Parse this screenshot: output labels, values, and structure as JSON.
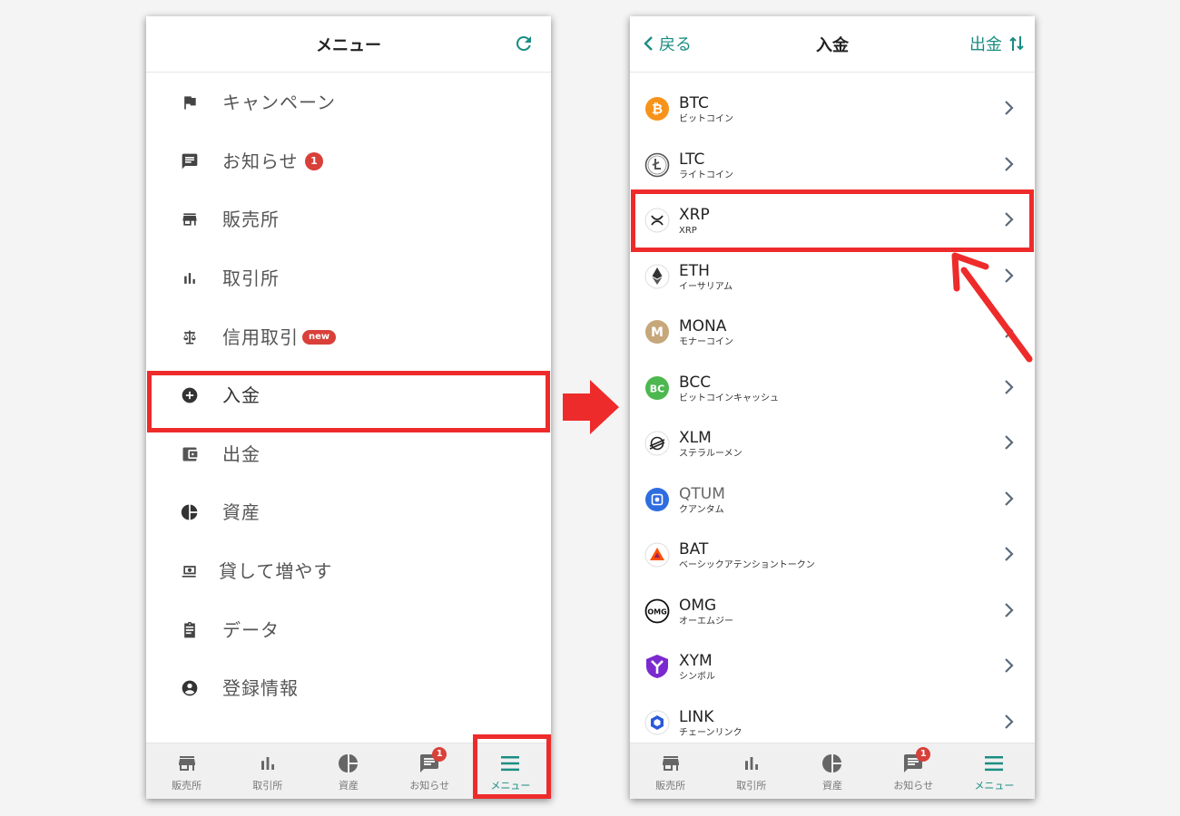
{
  "left": {
    "header_title": "メニュー",
    "menu": [
      {
        "label": "キャンペーン",
        "icon": "flag-icon"
      },
      {
        "label": "お知らせ",
        "icon": "message-icon",
        "badge": "1"
      },
      {
        "label": "販売所",
        "icon": "store-icon"
      },
      {
        "label": "取引所",
        "icon": "bar-chart-icon"
      },
      {
        "label": "信用取引",
        "icon": "scale-icon",
        "tag": "new"
      },
      {
        "label": "入金",
        "icon": "plus-circle-icon"
      },
      {
        "label": "出金",
        "icon": "wallet-icon"
      },
      {
        "label": "資産",
        "icon": "pie-chart-icon"
      },
      {
        "label": "貸して増やす",
        "icon": "money-icon"
      },
      {
        "label": "データ",
        "icon": "clipboard-icon"
      },
      {
        "label": "登録情報",
        "icon": "account-icon"
      }
    ]
  },
  "right": {
    "back_label": "戻る",
    "header_title": "入金",
    "withdraw_label": "出金",
    "coins": [
      {
        "symbol": "BTC",
        "name": "ビットコイン",
        "color": "#f7931a"
      },
      {
        "symbol": "LTC",
        "name": "ライトコイン",
        "color": "#8a8a8a"
      },
      {
        "symbol": "XRP",
        "name": "XRP",
        "color": "#23292f"
      },
      {
        "symbol": "ETH",
        "name": "イーサリアム",
        "color": "#3c3c3d"
      },
      {
        "symbol": "MONA",
        "name": "モナーコイン",
        "color": "#c6a77a"
      },
      {
        "symbol": "BCC",
        "name": "ビットコインキャッシュ",
        "color": "#4cb84f"
      },
      {
        "symbol": "XLM",
        "name": "ステラルーメン",
        "color": "#222222"
      },
      {
        "symbol": "QTUM",
        "name": "クアンタム",
        "color": "#2e6de0"
      },
      {
        "symbol": "BAT",
        "name": "ベーシックアテンショントークン",
        "color": "#ff5000"
      },
      {
        "symbol": "OMG",
        "name": "オーエムジー",
        "color": "#101010"
      },
      {
        "symbol": "XYM",
        "name": "シンボル",
        "color": "#7b2ad0"
      },
      {
        "symbol": "LINK",
        "name": "チェーンリンク",
        "color": "#2a5ada"
      }
    ]
  },
  "tabs": [
    {
      "label": "販売所",
      "icon": "store-icon"
    },
    {
      "label": "取引所",
      "icon": "bar-chart-icon"
    },
    {
      "label": "資産",
      "icon": "pie-chart-icon"
    },
    {
      "label": "お知らせ",
      "icon": "message-icon",
      "badge": "1"
    },
    {
      "label": "メニュー",
      "icon": "hamburger-icon",
      "active": true
    }
  ],
  "colors": {
    "accent": "#1b8d82",
    "highlight": "#ee2b2b",
    "badge": "#d9403a"
  }
}
